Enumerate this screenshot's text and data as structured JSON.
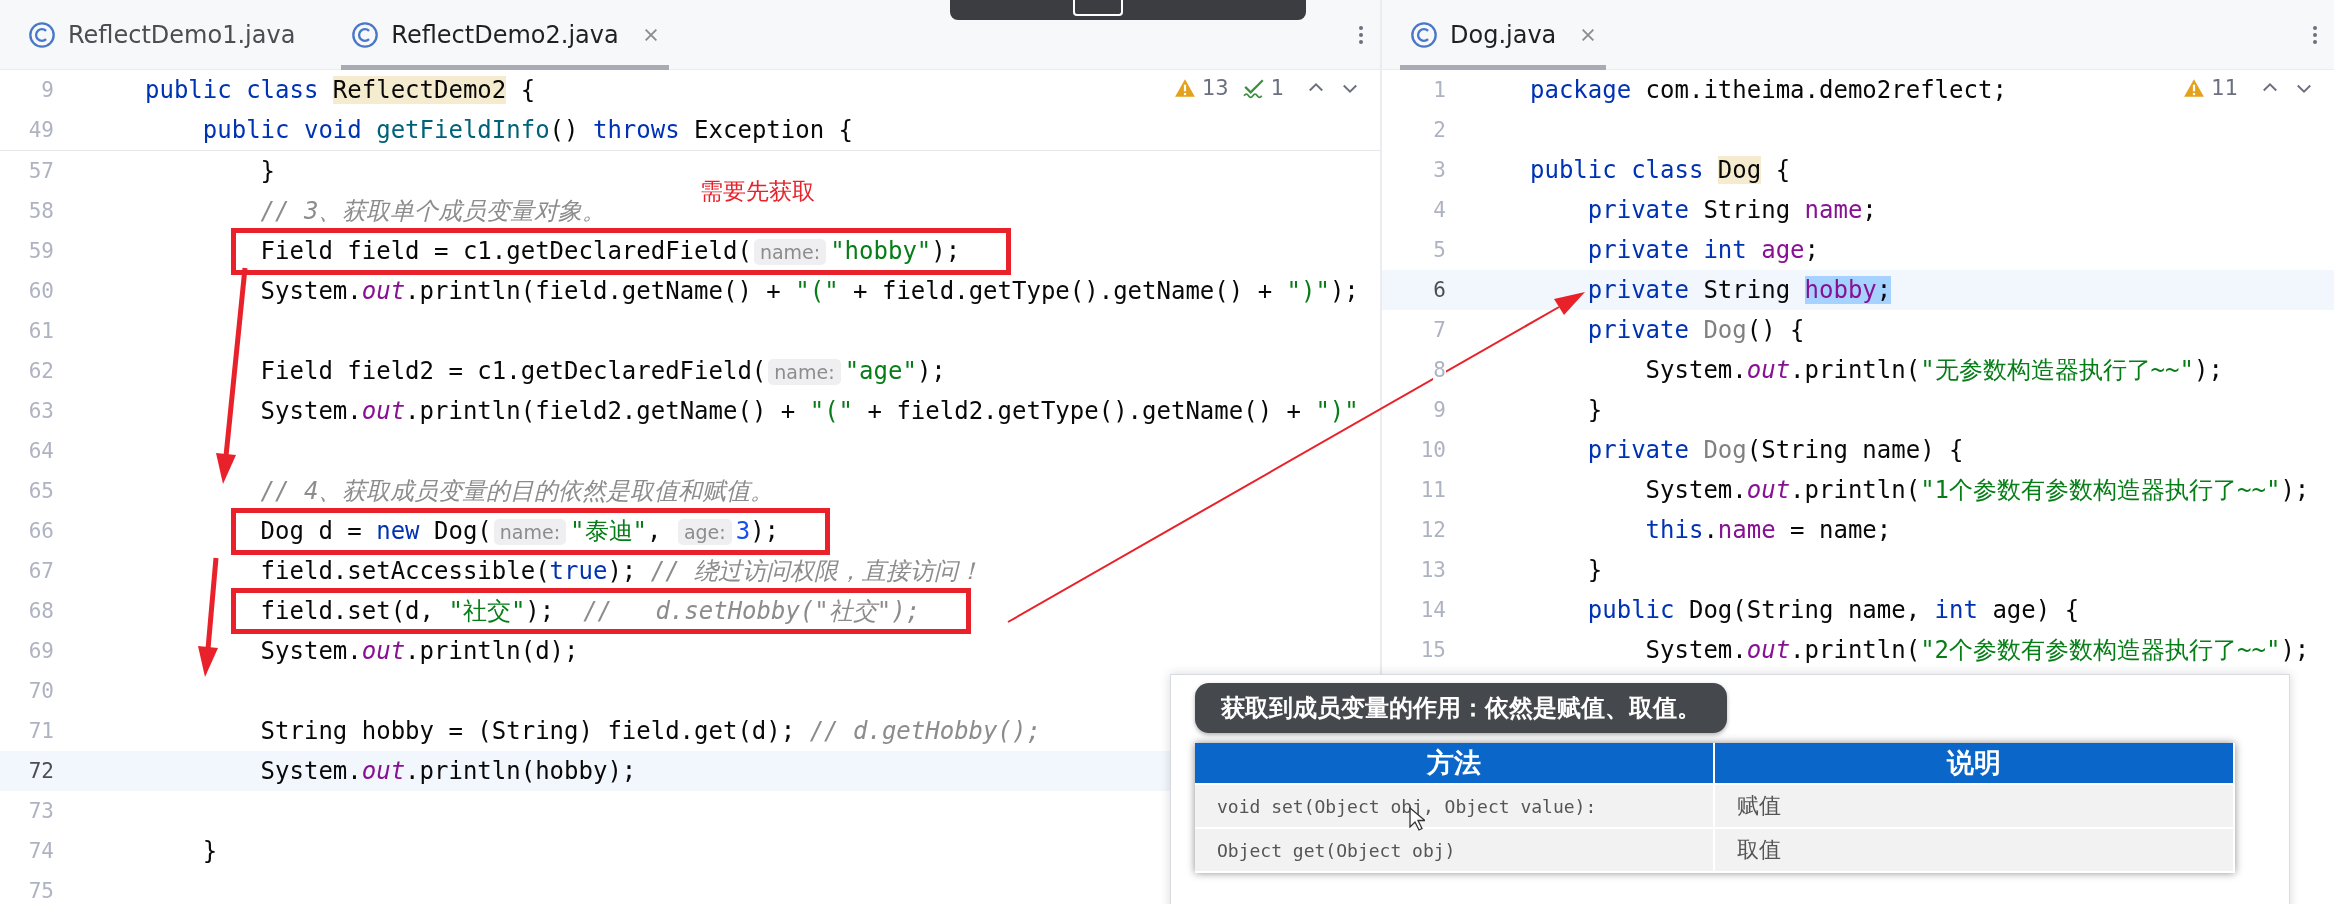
{
  "editors": [
    {
      "tabs": [
        {
          "label": "ReflectDemo1.java",
          "selected": false
        },
        {
          "label": "ReflectDemo2.java",
          "selected": true
        }
      ],
      "inspections": [
        {
          "kind": "warning",
          "count": "13"
        },
        {
          "kind": "typo",
          "count": "1"
        }
      ],
      "sticky_lines": [
        {
          "number": "9",
          "tokens": [
            {
              "kind": "keyword",
              "text": "public class "
            },
            {
              "kind": "class-ref",
              "text": "ReflectDemo2"
            },
            {
              "kind": "plain",
              "text": " {"
            }
          ]
        },
        {
          "number": "49",
          "tokens": [
            {
              "kind": "keyword",
              "text": "    public void "
            },
            {
              "kind": "method",
              "text": "getFieldInfo"
            },
            {
              "kind": "plain",
              "text": "() "
            },
            {
              "kind": "keyword",
              "text": "throws"
            },
            {
              "kind": "plain",
              "text": " Exception {"
            }
          ]
        }
      ],
      "lines": [
        {
          "number": "57",
          "current": false,
          "boxed": false,
          "tokens": [
            {
              "kind": "plain",
              "text": "        }"
            }
          ]
        },
        {
          "number": "58",
          "current": false,
          "boxed": false,
          "tokens": [
            {
              "kind": "comment",
              "text": "        // 3、获取单个成员变量对象。"
            }
          ]
        },
        {
          "number": "59",
          "current": false,
          "boxed": true,
          "tokens": [
            {
              "kind": "plain",
              "text": "        Field field = c1.getDeclaredField("
            },
            {
              "kind": "hint",
              "text": "name:"
            },
            {
              "kind": "string",
              "text": "\"hobby\""
            },
            {
              "kind": "plain",
              "text": ");"
            }
          ]
        },
        {
          "number": "60",
          "current": false,
          "boxed": false,
          "tokens": [
            {
              "kind": "plain",
              "text": "        System."
            },
            {
              "kind": "static",
              "text": "out"
            },
            {
              "kind": "plain",
              "text": ".println(field.getName() + "
            },
            {
              "kind": "string",
              "text": "\"(\""
            },
            {
              "kind": "plain",
              "text": " + field.getType().getName() + "
            },
            {
              "kind": "string",
              "text": "\")\""
            },
            {
              "kind": "plain",
              "text": ");"
            }
          ]
        },
        {
          "number": "61",
          "current": false,
          "boxed": false
        },
        {
          "number": "62",
          "current": false,
          "boxed": false,
          "tokens": [
            {
              "kind": "plain",
              "text": "        Field field2 = c1.getDeclaredField("
            },
            {
              "kind": "hint",
              "text": "name:"
            },
            {
              "kind": "string",
              "text": "\"age\""
            },
            {
              "kind": "plain",
              "text": ");"
            }
          ]
        },
        {
          "number": "63",
          "current": false,
          "boxed": false,
          "tokens": [
            {
              "kind": "plain",
              "text": "        System."
            },
            {
              "kind": "static",
              "text": "out"
            },
            {
              "kind": "plain",
              "text": ".println(field2.getName() + "
            },
            {
              "kind": "string",
              "text": "\"(\""
            },
            {
              "kind": "plain",
              "text": " + field2.getType().getName() + "
            },
            {
              "kind": "string",
              "text": "\")\""
            }
          ]
        },
        {
          "number": "64",
          "current": false,
          "boxed": false
        },
        {
          "number": "65",
          "current": false,
          "boxed": false,
          "tokens": [
            {
              "kind": "comment",
              "text": "        // 4、获取成员变量的目的依然是取值和赋值。"
            }
          ]
        },
        {
          "number": "66",
          "current": false,
          "boxed": true,
          "tokens": [
            {
              "kind": "plain",
              "text": "        Dog d = "
            },
            {
              "kind": "keyword",
              "text": "new"
            },
            {
              "kind": "plain",
              "text": " Dog("
            },
            {
              "kind": "hint",
              "text": "name:"
            },
            {
              "kind": "string",
              "text": "\"泰迪\""
            },
            {
              "kind": "plain",
              "text": ", "
            },
            {
              "kind": "hint",
              "text": "age:"
            },
            {
              "kind": "number",
              "text": "3"
            },
            {
              "kind": "plain",
              "text": ");"
            }
          ]
        },
        {
          "number": "67",
          "current": false,
          "boxed": false,
          "tokens": [
            {
              "kind": "plain",
              "text": "        field.setAccessible("
            },
            {
              "kind": "keyword",
              "text": "true"
            },
            {
              "kind": "plain",
              "text": "); "
            },
            {
              "kind": "comment",
              "text": "// 绕过访问权限，直接访问！"
            }
          ]
        },
        {
          "number": "68",
          "current": false,
          "boxed": true,
          "tokens": [
            {
              "kind": "plain",
              "text": "        field.set(d, "
            },
            {
              "kind": "string",
              "text": "\"社交\""
            },
            {
              "kind": "plain",
              "text": ");  "
            },
            {
              "kind": "comment",
              "text": "//   d.setHobby(\"社交\");"
            }
          ]
        },
        {
          "number": "69",
          "current": false,
          "boxed": false,
          "tokens": [
            {
              "kind": "plain",
              "text": "        System."
            },
            {
              "kind": "static",
              "text": "out"
            },
            {
              "kind": "plain",
              "text": ".println(d);"
            }
          ]
        },
        {
          "number": "70",
          "current": false,
          "boxed": false
        },
        {
          "number": "71",
          "current": false,
          "boxed": false,
          "tokens": [
            {
              "kind": "plain",
              "text": "        String hobby = (String) field.get(d); "
            },
            {
              "kind": "comment",
              "text": "// d.getHobby();"
            }
          ]
        },
        {
          "number": "72",
          "current": true,
          "boxed": false,
          "tokens": [
            {
              "kind": "plain",
              "text": "        System."
            },
            {
              "kind": "static",
              "text": "out"
            },
            {
              "kind": "plain",
              "text": ".println(hobby);"
            }
          ]
        },
        {
          "number": "73",
          "current": false,
          "boxed": false
        },
        {
          "number": "74",
          "current": false,
          "boxed": false,
          "tokens": [
            {
              "kind": "plain",
              "text": "    }"
            }
          ]
        },
        {
          "number": "75",
          "current": false,
          "boxed": false
        }
      ]
    },
    {
      "tabs": [
        {
          "label": "Dog.java",
          "selected": true
        }
      ],
      "inspections": [
        {
          "kind": "warning",
          "count": "11"
        }
      ],
      "lines": [
        {
          "number": "1",
          "current": false,
          "tokens": [
            {
              "kind": "keyword",
              "text": "package"
            },
            {
              "kind": "plain",
              "text": " com.itheima.demo2reflect;"
            }
          ]
        },
        {
          "number": "2",
          "current": false
        },
        {
          "number": "3",
          "current": false,
          "tokens": [
            {
              "kind": "keyword",
              "text": "public class "
            },
            {
              "kind": "class-ref",
              "text": "Dog"
            },
            {
              "kind": "plain",
              "text": " {"
            }
          ]
        },
        {
          "number": "4",
          "current": false,
          "tokens": [
            {
              "kind": "keyword",
              "text": "    private"
            },
            {
              "kind": "plain",
              "text": " String "
            },
            {
              "kind": "field",
              "text": "name"
            },
            {
              "kind": "plain",
              "text": ";"
            }
          ]
        },
        {
          "number": "5",
          "current": false,
          "tokens": [
            {
              "kind": "keyword",
              "text": "    private int "
            },
            {
              "kind": "field",
              "text": "age"
            },
            {
              "kind": "plain",
              "text": ";"
            }
          ]
        },
        {
          "number": "6",
          "current": true,
          "tokens": [
            {
              "kind": "keyword",
              "text": "    private"
            },
            {
              "kind": "plain",
              "text": " String "
            },
            {
              "kind": "field-selected",
              "text": "hobby"
            },
            {
              "kind": "selected",
              "text": ";"
            }
          ]
        },
        {
          "number": "7",
          "current": false,
          "tokens": [
            {
              "kind": "keyword",
              "text": "    private "
            },
            {
              "kind": "unused",
              "text": "Dog"
            },
            {
              "kind": "plain",
              "text": "() {"
            }
          ]
        },
        {
          "number": "8",
          "current": false,
          "tokens": [
            {
              "kind": "plain",
              "text": "        System."
            },
            {
              "kind": "static",
              "text": "out"
            },
            {
              "kind": "plain",
              "text": ".println("
            },
            {
              "kind": "string",
              "text": "\"无参数构造器执行了~~\""
            },
            {
              "kind": "plain",
              "text": ");"
            }
          ]
        },
        {
          "number": "9",
          "current": false,
          "tokens": [
            {
              "kind": "plain",
              "text": "    }"
            }
          ]
        },
        {
          "number": "10",
          "current": false,
          "tokens": [
            {
              "kind": "keyword",
              "text": "    private "
            },
            {
              "kind": "unused",
              "text": "Dog"
            },
            {
              "kind": "plain",
              "text": "(String name) {"
            }
          ]
        },
        {
          "number": "11",
          "current": false,
          "tokens": [
            {
              "kind": "plain",
              "text": "        System."
            },
            {
              "kind": "static",
              "text": "out"
            },
            {
              "kind": "plain",
              "text": ".println("
            },
            {
              "kind": "string",
              "text": "\"1个参数有参数构造器执行了~~\""
            },
            {
              "kind": "plain",
              "text": ");"
            }
          ]
        },
        {
          "number": "12",
          "current": false,
          "tokens": [
            {
              "kind": "keyword",
              "text": "        this"
            },
            {
              "kind": "plain",
              "text": "."
            },
            {
              "kind": "field",
              "text": "name"
            },
            {
              "kind": "plain",
              "text": " = name;"
            }
          ]
        },
        {
          "number": "13",
          "current": false,
          "tokens": [
            {
              "kind": "plain",
              "text": "    }"
            }
          ]
        },
        {
          "number": "14",
          "current": false,
          "tokens": [
            {
              "kind": "keyword",
              "text": "    public"
            },
            {
              "kind": "plain",
              "text": " Dog(String name, "
            },
            {
              "kind": "keyword",
              "text": "int"
            },
            {
              "kind": "plain",
              "text": " age) {"
            }
          ]
        },
        {
          "number": "15",
          "current": false,
          "tokens": [
            {
              "kind": "plain",
              "text": "        System."
            },
            {
              "kind": "static",
              "text": "out"
            },
            {
              "kind": "plain",
              "text": ".println("
            },
            {
              "kind": "string",
              "text": "\"2个参数有参数构造器执行了~~\""
            },
            {
              "kind": "plain",
              "text": ");"
            }
          ]
        }
      ]
    }
  ],
  "annotation": {
    "note": "需要先获取"
  },
  "popup": {
    "title": "获取到成员变量的作用：依然是赋值、取值。",
    "table": {
      "columns": [
        "方法",
        "说明"
      ],
      "rows": [
        [
          "void set(Object obj, Object value):",
          "赋值"
        ],
        [
          "Object get(Object obj)",
          "取值"
        ]
      ]
    }
  }
}
